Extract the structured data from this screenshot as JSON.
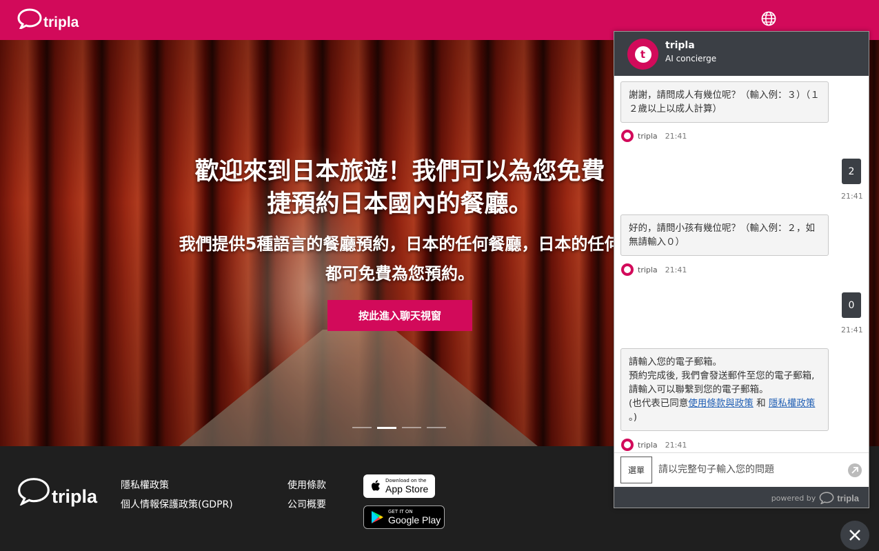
{
  "brand": {
    "name": "tripla",
    "color": "#d20a5a",
    "icon": "speech-bubble-icon"
  },
  "header": {
    "language_icon": "globe-icon"
  },
  "hero": {
    "title_line1": "歡迎來到日本旅遊！我們可以為您免費",
    "title_line2": "捷預約日本國內的餐廳。",
    "subtitle_line1": "我們提供5種語言的餐廳預約，日本的任何餐廳，日本的任何",
    "subtitle_line2": "都可免費為您預約。",
    "cta_label": "按此進入聊天視窗",
    "carousel_dots": 4,
    "carousel_active": 2
  },
  "footer": {
    "links_col1": [
      "隱私權政策",
      "個人情報保護政策(GDPR)"
    ],
    "links_col2": [
      "使用條款",
      "公司概要"
    ],
    "appstore": {
      "small": "Download on the",
      "big": "App Store"
    },
    "googleplay": {
      "small": "GET IT ON",
      "big": "Google Play"
    }
  },
  "chat": {
    "bot_name": "tripla",
    "bot_role": "AI concierge",
    "messages": [
      {
        "from": "bot",
        "text": "謝謝，請問成人有幾位呢？（輸入例：３）（１２歲以上以成人計算）",
        "sender": "tripla",
        "time": "21:41"
      },
      {
        "from": "user",
        "text": "2",
        "time": "21:41"
      },
      {
        "from": "bot",
        "text": "好的，請問小孩有幾位呢？（輸入例：２，如無請輸入０）",
        "sender": "tripla",
        "time": "21:41"
      },
      {
        "from": "user",
        "text": "0",
        "time": "21:41"
      },
      {
        "from": "bot",
        "line1": "請輸入您的電子郵箱。",
        "line2": "預約完成後, 我們會發送郵件至您的電子郵箱, 請輸入可以聯繫到您的電子郵箱。",
        "prefix": "(也代表已同意",
        "link1": "使用條款與政策",
        "mid": " 和 ",
        "link2": "隱私權政策",
        "suffix": " 。)",
        "sender": "tripla",
        "time": "21:41"
      }
    ],
    "menu_label": "選單",
    "input_placeholder": "請以完整句子輸入您的問題",
    "powered_by": "powered by",
    "powered_brand": "tripla"
  }
}
